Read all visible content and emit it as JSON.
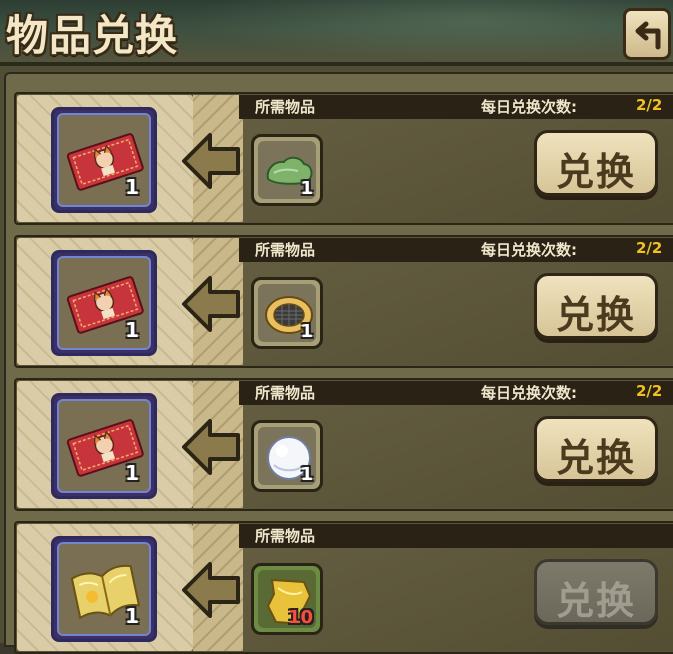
{
  "window": {
    "title": "物品兑换",
    "back_icon": "back-arrow-icon"
  },
  "rows": [
    {
      "required_label": "所需物品",
      "daily_label": "每日兑换次数:",
      "daily_count": "2/2",
      "reward": {
        "icon": "ticket-card-icon",
        "qty": "1"
      },
      "cost": {
        "icon": "green-slime-item-icon",
        "qty": "1",
        "qty_color": "#ffffff"
      },
      "button_label": "兑换",
      "button_enabled": true
    },
    {
      "required_label": "所需物品",
      "daily_label": "每日兑换次数:",
      "daily_count": "2/2",
      "reward": {
        "icon": "ticket-card-icon",
        "qty": "1"
      },
      "cost": {
        "icon": "golden-net-ring-icon",
        "qty": "1",
        "qty_color": "#ffffff"
      },
      "button_label": "兑换",
      "button_enabled": true
    },
    {
      "required_label": "所需物品",
      "daily_label": "每日兑换次数:",
      "daily_count": "2/2",
      "reward": {
        "icon": "ticket-card-icon",
        "qty": "1"
      },
      "cost": {
        "icon": "white-fluff-ball-icon",
        "qty": "1",
        "qty_color": "#ffffff"
      },
      "button_label": "兑换",
      "button_enabled": true
    },
    {
      "required_label": "所需物品",
      "daily_label": "",
      "daily_count": "",
      "reward": {
        "icon": "golden-book-icon",
        "qty": "1"
      },
      "cost": {
        "icon": "golden-leaf-fragment-icon",
        "qty": "10",
        "qty_color": "#ff4b3a"
      },
      "button_label": "兑换",
      "button_enabled": false
    }
  ]
}
